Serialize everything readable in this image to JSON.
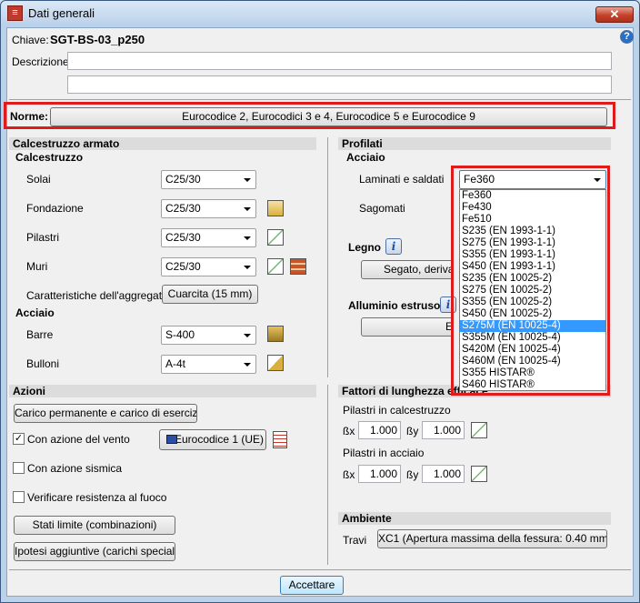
{
  "window": {
    "title": "Dati generali",
    "close_glyph": "✕"
  },
  "header": {
    "chiave_label": "Chiave:",
    "chiave_value": "SGT-BS-03_p250",
    "descrizione_label": "Descrizione:",
    "help_glyph": "?"
  },
  "norme": {
    "label": "Norme:",
    "button": "Eurocodice 2, Eurocodici 3 e 4, Eurocodice 5 e Eurocodice 9"
  },
  "calcestruzzo_armato": {
    "title": "Calcestruzzo armato",
    "calcestruzzo_title": "Calcestruzzo",
    "rows": [
      {
        "label": "Solai",
        "value": "C25/30"
      },
      {
        "label": "Fondazione",
        "value": "C25/30"
      },
      {
        "label": "Pilastri",
        "value": "C25/30"
      },
      {
        "label": "Muri",
        "value": "C25/30"
      }
    ],
    "aggregato_label": "Caratteristiche dell'aggregato",
    "aggregato_button": "Cuarcita (15 mm)",
    "acciaio_title": "Acciaio",
    "barre_label": "Barre",
    "barre_value": "S-400",
    "bulloni_label": "Bulloni",
    "bulloni_value": "A-4t"
  },
  "profilati": {
    "title": "Profilati",
    "acciaio_title": "Acciaio",
    "laminati_label": "Laminati e saldati",
    "laminati_value": "Fe360",
    "sagomati_label": "Sagomati",
    "legno_title": "Legno",
    "legno_button": "Segato, derivame",
    "alluminio_title": "Alluminio estruso",
    "alluminio_button": "E",
    "info_glyph": "i"
  },
  "dropdown": {
    "options": [
      "Fe360",
      "Fe430",
      "Fe510",
      "S235 (EN 1993-1-1)",
      "S275 (EN 1993-1-1)",
      "S355 (EN 1993-1-1)",
      "S450 (EN 1993-1-1)",
      "S235 (EN 10025-2)",
      "S275 (EN 10025-2)",
      "S355 (EN 10025-2)",
      "S450 (EN 10025-2)",
      "S275M (EN 10025-4)",
      "S355M (EN 10025-4)",
      "S420M (EN 10025-4)",
      "S460M (EN 10025-4)",
      "S355 HISTAR®",
      "S460 HISTAR®"
    ],
    "selected_index": 11
  },
  "azioni": {
    "title": "Azioni",
    "carico_button": "Carico permanente e carico di esercizio",
    "vento_label": "Con azione del vento",
    "vento_checked": true,
    "vento_button": "Eurocodice 1 (UE)",
    "sismica_label": "Con azione sismica",
    "sismica_checked": false,
    "fuoco_label": "Verificare resistenza al fuoco",
    "fuoco_checked": false,
    "stati_button": "Stati limite (combinazioni)",
    "ipotesi_button": "Ipotesi aggiuntive (carichi speciali)",
    "check_glyph": "✓"
  },
  "fattori": {
    "title": "Fattori di lunghezza efficace",
    "calcestruzzo_label": "Pilastri in calcestruzzo",
    "acciaio_label": "Pilastri in acciaio",
    "bx_label": "ßx",
    "by_label": "ßy",
    "calc_bx": "1.000",
    "calc_by": "1.000",
    "acc_bx": "1.000",
    "acc_by": "1.000"
  },
  "ambiente": {
    "title": "Ambiente",
    "travi_label": "Travi",
    "travi_button": "XC1 (Apertura massima della fessura: 0.40 mm)"
  },
  "footer": {
    "accept_button": "Accettare"
  },
  "colors": {
    "highlight": "#e01b1b",
    "selection": "#3399ff"
  }
}
